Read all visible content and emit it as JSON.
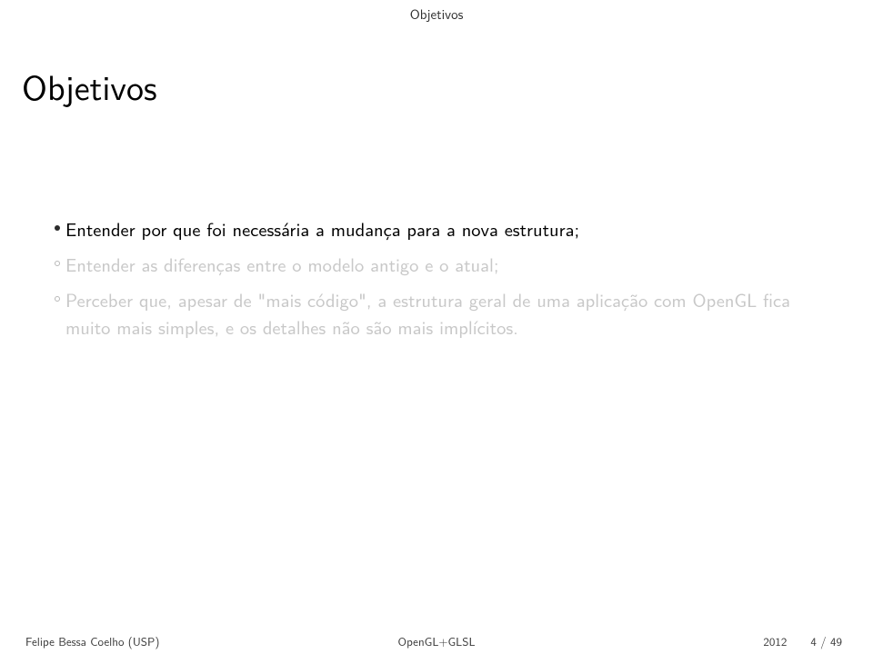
{
  "header": {
    "section": "Objetivos"
  },
  "title": "Objetivos",
  "bullets": [
    {
      "text": "Entender por que foi necessária a mudança para a nova estrutura;",
      "status": "current"
    },
    {
      "text": "Entender as diferenças entre o modelo antigo e o atual;",
      "status": "dim"
    },
    {
      "text": "Perceber que, apesar de \"mais código\", a estrutura geral de uma aplicação com OpenGL fica muito mais simples, e os detalhes não são mais implícitos.",
      "status": "dim"
    }
  ],
  "footer": {
    "left": "Felipe Bessa Coelho (USP)",
    "center": "OpenGL+GLSL",
    "year": "2012",
    "page_current": "4",
    "page_total": "49"
  }
}
